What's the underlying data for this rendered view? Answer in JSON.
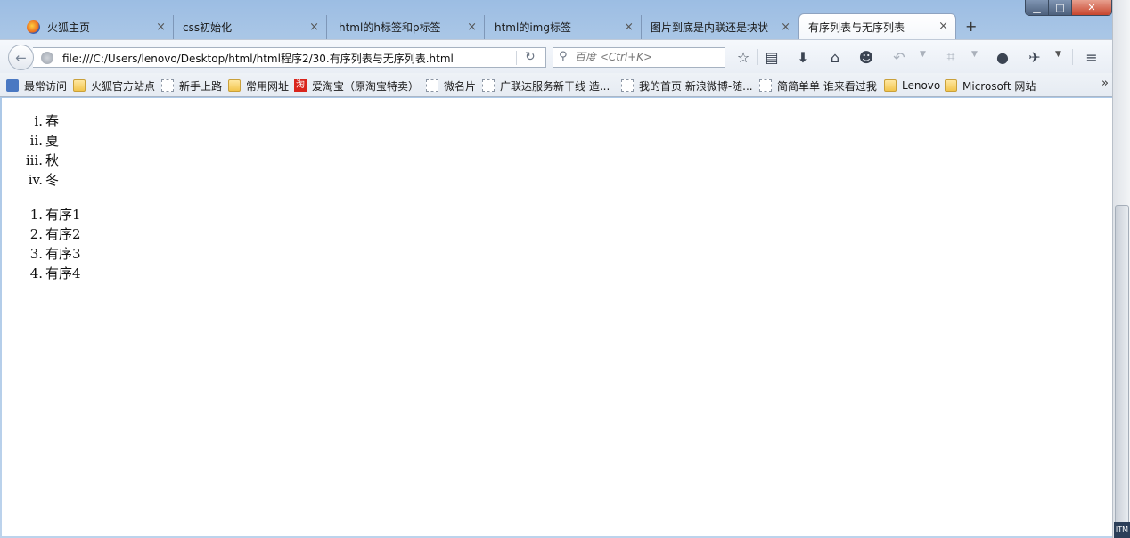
{
  "window": {
    "title": "有序列表与无序列表"
  },
  "tabs": [
    {
      "label": "火狐主页",
      "close": "×"
    },
    {
      "label": "css初始化",
      "close": "×"
    },
    {
      "label": "html的h标签和p标签",
      "close": "×"
    },
    {
      "label": "html的img标签",
      "close": "×"
    },
    {
      "label": "图片到底是内联还是块状",
      "close": "×"
    },
    {
      "label": "有序列表与无序列表",
      "close": "×",
      "active": true
    }
  ],
  "new_tab_label": "+",
  "navbar": {
    "url": "file:///C:/Users/lenovo/Desktop/html/html程序2/30.有序列表与无序列表.html",
    "search_placeholder": "百度 <Ctrl+K>",
    "icons": [
      "back-arrow-icon",
      "reload-icon",
      "search-icon",
      "bookmark-star-icon",
      "reading-list-icon",
      "download-icon",
      "home-icon",
      "chat-icon",
      "undo-icon",
      "crop-icon",
      "speech-bubble-icon",
      "bird-icon",
      "hamburger-menu-icon"
    ]
  },
  "bookmarks": [
    {
      "label": "最常访问",
      "icon": "star"
    },
    {
      "label": "火狐官方站点",
      "icon": "folder"
    },
    {
      "label": "新手上路",
      "icon": "page"
    },
    {
      "label": "常用网址",
      "icon": "folder"
    },
    {
      "label": "爱淘宝（原淘宝特卖）",
      "icon": "taobao"
    },
    {
      "label": "微名片",
      "icon": "page"
    },
    {
      "label": "广联达服务新干线 造...",
      "icon": "page"
    },
    {
      "label": "我的首页 新浪微博-随...",
      "icon": "page"
    },
    {
      "label": "简简单单 谁来看过我",
      "icon": "page"
    },
    {
      "label": "Lenovo",
      "icon": "folder"
    },
    {
      "label": "Microsoft 网站",
      "icon": "folder"
    }
  ],
  "bookmarks_overflow": "»",
  "taobao_glyph": "淘",
  "content": {
    "roman_list": [
      {
        "marker": "i.",
        "text": "春"
      },
      {
        "marker": "ii.",
        "text": "夏"
      },
      {
        "marker": "iii.",
        "text": "秋"
      },
      {
        "marker": "iv.",
        "text": "冬"
      }
    ],
    "decimal_list": [
      {
        "marker": "1.",
        "text": "有序1"
      },
      {
        "marker": "2.",
        "text": "有序2"
      },
      {
        "marker": "3.",
        "text": "有序3"
      },
      {
        "marker": "4.",
        "text": "有序4"
      }
    ]
  },
  "taskbar_text": "ITM"
}
